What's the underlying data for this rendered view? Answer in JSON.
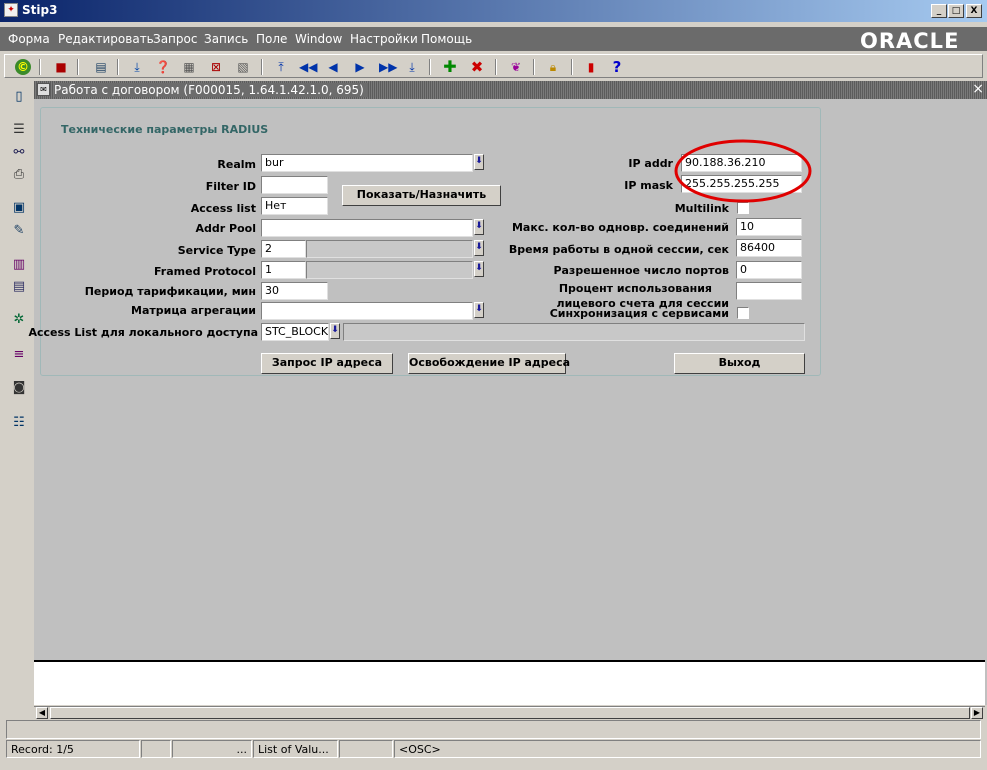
{
  "window": {
    "title": "Stip3",
    "buttons": {
      "minimize": "_",
      "maximize": "□",
      "close": "X"
    }
  },
  "menubar": {
    "items": [
      "Форма",
      "Редактировать",
      "Запрос",
      "Запись",
      "Поле",
      "Window",
      "Настройки",
      "Помощь"
    ],
    "brand": "ORACLE"
  },
  "inner_window": {
    "title": "Работа с договором (F000015, 1.64.1.42.1.0, 695)",
    "close": "×"
  },
  "form": {
    "section_title": "Технические параметры RADIUS",
    "realm": {
      "label": "Realm",
      "value": "bur"
    },
    "filter_id": {
      "label": "Filter ID",
      "value": ""
    },
    "show_assign_button": "Показать/Назначить",
    "access_list": {
      "label": "Access list",
      "value": "Нет"
    },
    "addr_pool": {
      "label": "Addr Pool",
      "value": ""
    },
    "service_type": {
      "label": "Service Type",
      "value": "2"
    },
    "framed_protocol": {
      "label": "Framed Protocol",
      "value": "1"
    },
    "tariff_period": {
      "label": "Период тарификации, мин",
      "value": "30"
    },
    "aggregation_matrix": {
      "label": "Матрица агрегации",
      "value": ""
    },
    "local_access_list": {
      "label": "Access List для локального доступа",
      "value": "STC_BLOCK_"
    },
    "ip_addr": {
      "label": "IP addr",
      "value": "90.188.36.210"
    },
    "ip_mask": {
      "label": "IP mask",
      "value": "255.255.255.255"
    },
    "multilink": {
      "label": "Multilink"
    },
    "max_connections": {
      "label": "Макс. кол-во одновр. соединений",
      "value": "10"
    },
    "session_time": {
      "label": "Время работы в одной сессии, сек",
      "value": "86400"
    },
    "allowed_ports": {
      "label": "Разрешенное число портов",
      "value": "0"
    },
    "account_usage": {
      "label_line1": "Процент использования",
      "label_line2": "лицевого счета для сессии",
      "value": ""
    },
    "sync_services": {
      "label": "Синхронизация с сервисами"
    },
    "buttons": {
      "request_ip": "Запрос IP адреса",
      "release_ip": "Освобождение IP адреса",
      "exit": "Выход"
    }
  },
  "statusbar": {
    "record": "Record: 1/5",
    "ellipsis": "...",
    "list_of_values": "List of Valu...",
    "osc": "<OSC>"
  },
  "colors": {
    "title_bar": "#0a246a",
    "menubar": "#6b6b6b",
    "section_title": "#336666",
    "annotation": "#e00000"
  },
  "icons": {
    "toolbar": [
      "oracle-c-icon",
      "save-icon",
      "print-icon",
      "download-icon",
      "query-icon",
      "enter-query-icon",
      "cancel-query-icon",
      "count-query-icon",
      "first-record-icon",
      "previous-block-icon",
      "previous-record-icon",
      "next-record-icon",
      "next-block-icon",
      "last-record-icon",
      "insert-record-icon",
      "delete-record-icon",
      "help-topic-icon",
      "lock-icon",
      "exit-icon",
      "help-icon"
    ],
    "left_strip": [
      "door-icon",
      "list-icon",
      "network-icon",
      "printer-icon",
      "floppy-icon",
      "wrench-icon",
      "chart-icon",
      "document-icon",
      "tree-icon",
      "menu-icon",
      "camera-icon",
      "report-icon"
    ]
  }
}
